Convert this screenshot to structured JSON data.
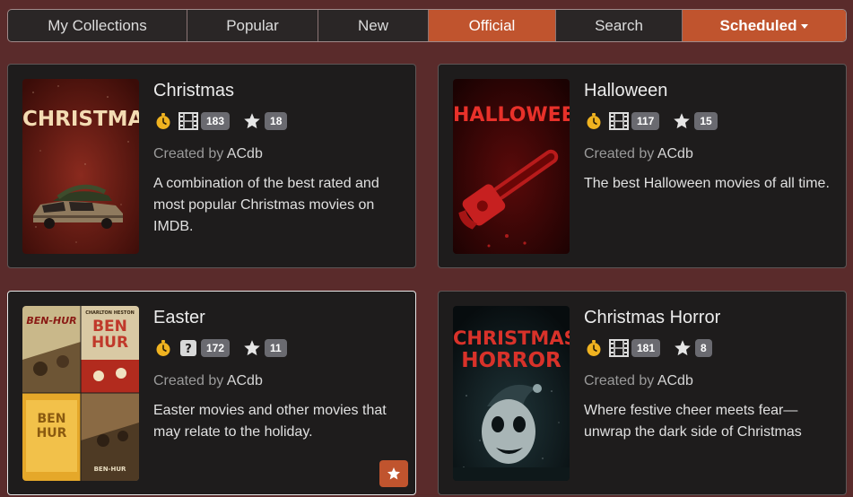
{
  "tabs": [
    {
      "label": "My Collections",
      "active": false
    },
    {
      "label": "Popular",
      "active": false
    },
    {
      "label": "New",
      "active": false
    },
    {
      "label": "Official",
      "active": true
    },
    {
      "label": "Search",
      "active": false
    },
    {
      "label": "Scheduled",
      "active": true
    }
  ],
  "created_by_prefix": "Created by",
  "cards": [
    {
      "title": "Christmas",
      "media_icon": "film-icon",
      "count": "183",
      "stars": "18",
      "creator": "ACdb",
      "description": "A combination of the best rated and most popular Christmas movies on IMDB.",
      "poster_text": "CHRISTMAS"
    },
    {
      "title": "Halloween",
      "media_icon": "film-icon",
      "count": "117",
      "stars": "15",
      "creator": "ACdb",
      "description": "The best Halloween movies of all time.",
      "poster_text": "HALLOWEEN"
    },
    {
      "title": "Easter",
      "media_icon": "question-icon",
      "count": "172",
      "stars": "11",
      "creator": "ACdb",
      "description": "Easter movies and other movies that may relate to the holiday.",
      "poster_text_tl": "BEN-HUR",
      "poster_text_tr": "BEN HUR",
      "poster_text_bl": "BEN HUR",
      "poster_text_br": "BEN-HUR",
      "poster_small_tr": "CHARLTON HESTON"
    },
    {
      "title": "Christmas Horror",
      "media_icon": "film-icon",
      "count": "181",
      "stars": "8",
      "creator": "ACdb",
      "description": "Where festive cheer meets fear—unwrap the dark side of Christmas",
      "poster_text_1": "CHRISTMAS",
      "poster_text_2": "HORROR"
    }
  ],
  "colors": {
    "background": "#5a2b2b",
    "card": "#1e1c1c",
    "accent": "#c0542e",
    "badge": "#6a6a70"
  }
}
